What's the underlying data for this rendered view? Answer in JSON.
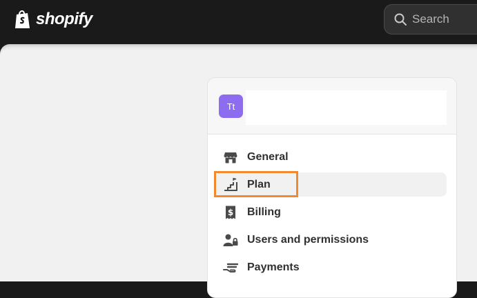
{
  "brand": {
    "name": "shopify"
  },
  "search": {
    "label": "Search"
  },
  "store": {
    "avatar_initials": "Tt"
  },
  "settings_nav": {
    "items": [
      {
        "label": "General",
        "icon": "store-icon",
        "selected": false
      },
      {
        "label": "Plan",
        "icon": "plan-steps-icon",
        "selected": true
      },
      {
        "label": "Billing",
        "icon": "billing-receipt-icon",
        "selected": false
      },
      {
        "label": "Users and permissions",
        "icon": "users-lock-icon",
        "selected": false
      },
      {
        "label": "Payments",
        "icon": "payments-hand-icon",
        "selected": false
      }
    ]
  },
  "colors": {
    "topbar": "#1a1a1a",
    "avatar": "#8d6cf0",
    "highlight": "#f08a2c",
    "selected_item_bg": "#f1f1f1"
  }
}
